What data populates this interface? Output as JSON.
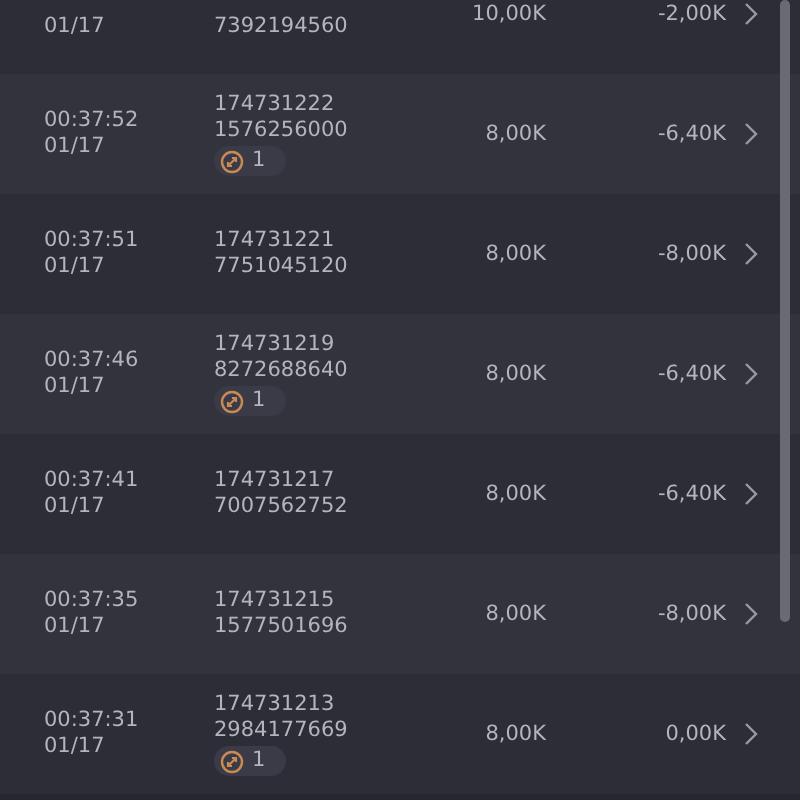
{
  "orders": [
    {
      "date": "01/17",
      "id_suffix": "7392194560",
      "amount": "10,00K",
      "pnl": "-2,00K"
    },
    {
      "time": "00:37:52",
      "date": "01/17",
      "id": "174731222",
      "id_suffix": "1576256000",
      "badge": "1",
      "amount": "8,00K",
      "pnl": "-6,40K"
    },
    {
      "time": "00:37:51",
      "date": "01/17",
      "id": "174731221",
      "id_suffix": "7751045120",
      "amount": "8,00K",
      "pnl": "-8,00K"
    },
    {
      "time": "00:37:46",
      "date": "01/17",
      "id": "174731219",
      "id_suffix": "8272688640",
      "badge": "1",
      "amount": "8,00K",
      "pnl": "-6,40K"
    },
    {
      "time": "00:37:41",
      "date": "01/17",
      "id": "174731217",
      "id_suffix": "7007562752",
      "amount": "8,00K",
      "pnl": "-6,40K"
    },
    {
      "time": "00:37:35",
      "date": "01/17",
      "id": "174731215",
      "id_suffix": "1577501696",
      "amount": "8,00K",
      "pnl": "-8,00K"
    },
    {
      "time": "00:37:31",
      "date": "01/17",
      "id": "174731213",
      "id_suffix": "2984177669",
      "badge": "1",
      "amount": "8,00K",
      "pnl": "0,00K"
    }
  ]
}
